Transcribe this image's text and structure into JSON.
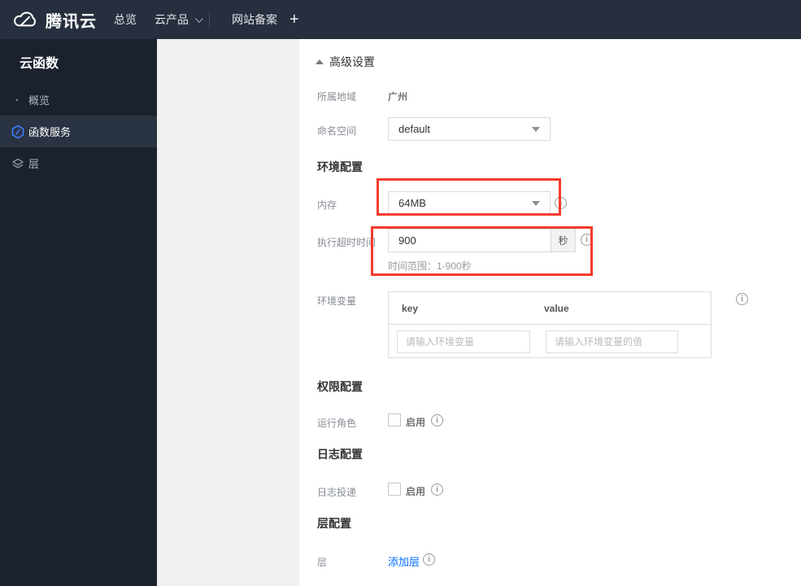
{
  "topnav": {
    "brand": "腾讯云",
    "items": [
      {
        "label": "总览"
      },
      {
        "label": "云产品"
      },
      {
        "label": "网站备案"
      }
    ],
    "new_tab": "+"
  },
  "sidebar": {
    "title": "云函数",
    "items": [
      {
        "label": "概览",
        "icon": "overview-grid-icon",
        "selected": false
      },
      {
        "label": "函数服务",
        "icon": "function-service-icon",
        "selected": true
      },
      {
        "label": "层",
        "icon": "layers-icon",
        "selected": false
      }
    ]
  },
  "content": {
    "collapse_toggle": "高级设置",
    "region": {
      "label": "所属地域",
      "value": "广州"
    },
    "namespace": {
      "label": "命名空间",
      "value": "default"
    },
    "section_env": "环境配置",
    "memory": {
      "label": "内存",
      "value": "64MB"
    },
    "timeout": {
      "label": "执行超时时间",
      "value": "900",
      "unit": "秒",
      "hint": "时间范围：1-900秒"
    },
    "env_vars": {
      "label": "环境变量",
      "headers": [
        "key",
        "value"
      ],
      "key_placeholder": "请输入环境变量",
      "value_placeholder": "请输入环境变量的值"
    },
    "section_perm": "权限配置",
    "role": {
      "label": "运行角色",
      "toggle": "启用"
    },
    "section_log": "日志配置",
    "log": {
      "label": "日志投递",
      "toggle": "启用"
    },
    "section_layer": "层配置",
    "layer": {
      "label": "层",
      "link": "添加层"
    }
  },
  "colors": {
    "highlight_red": "#f43b2c",
    "link_blue": "#006eff",
    "topnav_bg": "#272f3e",
    "sidebar_bg": "#1b222e",
    "sidebar_selected_bg": "#2a3342",
    "function_icon_blue": "#3d7fff"
  }
}
